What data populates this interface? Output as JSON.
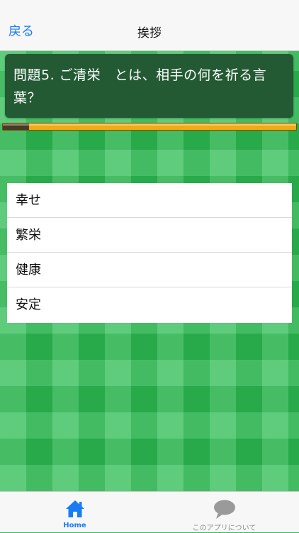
{
  "navbar": {
    "back_label": "戻る",
    "title": "挨拶"
  },
  "question": {
    "text": "問題5. ご清栄　とは、相手の何を祈る言葉？",
    "progress_fraction": 0.09
  },
  "answers": [
    {
      "label": "幸せ"
    },
    {
      "label": "繁栄"
    },
    {
      "label": "健康"
    },
    {
      "label": "安定"
    }
  ],
  "tabbar": {
    "home_label": "Home",
    "about_label": "このアプリについて",
    "home_icon": "house-icon",
    "about_icon": "speech-bubble-icon"
  },
  "colors": {
    "accent": "#1a7cf5",
    "question_bg": "#235a34",
    "progress_track": "#f3a914",
    "progress_fill": "#4a3a22",
    "background_green": "#2dbd53"
  }
}
